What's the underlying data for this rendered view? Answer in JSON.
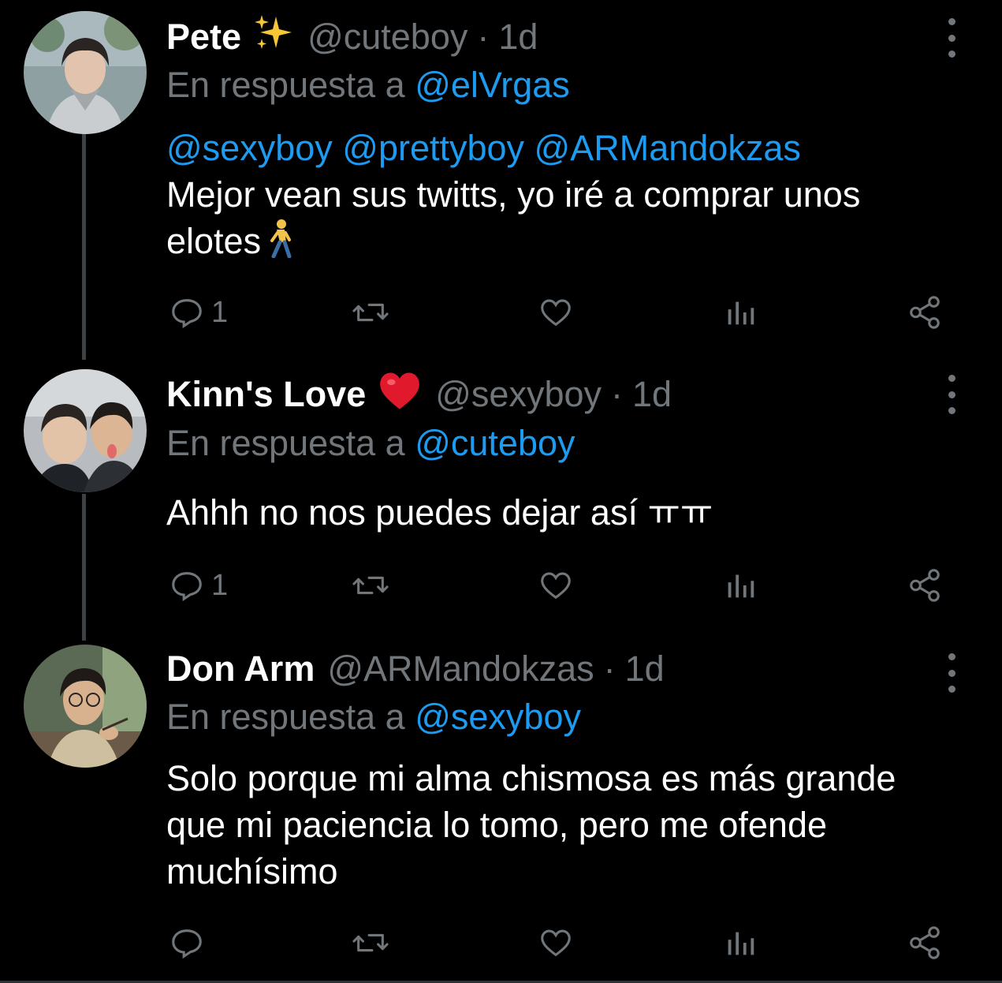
{
  "tweets": [
    {
      "display_name": "Pete",
      "name_emoji": "sparkles-emoji",
      "handle": "@cuteboy",
      "separator": "·",
      "time": "1d",
      "reply_prefix": "En respuesta a",
      "reply_to": "@elVrgas",
      "mentions": "@sexyboy @prettyboy @ARMandokzas",
      "text": "Mejor vean sus twitts, yo iré a comprar unos elotes",
      "text_emoji": "person-walking-emoji",
      "reply_count": "1"
    },
    {
      "display_name": "Kinn's Love",
      "name_emoji": "red-heart-emoji",
      "handle": "@sexyboy",
      "separator": "·",
      "time": "1d",
      "reply_prefix": "En respuesta a",
      "reply_to": "@cuteboy",
      "text": "Ahhh no nos puedes dejar así ㅠㅠ",
      "reply_count": "1"
    },
    {
      "display_name": "Don Arm",
      "handle": "@ARMandokzas",
      "separator": "·",
      "time": "1d",
      "reply_prefix": "En respuesta a",
      "reply_to": "@sexyboy",
      "text": "Solo porque mi alma chismosa es más grande que mi paciencia lo tomo, pero me ofende muchísimo",
      "reply_count": ""
    }
  ],
  "icons": {
    "reply": "speech-bubble-icon",
    "retweet": "retweet-icon",
    "like": "heart-icon",
    "views": "bar-chart-icon",
    "share": "share-icon",
    "more": "three-dots-vertical-icon"
  },
  "colors": {
    "background": "#000000",
    "text_primary": "#ffffff",
    "text_secondary": "#71767b",
    "link": "#1d9bf0",
    "thread_line": "#3e4144"
  }
}
